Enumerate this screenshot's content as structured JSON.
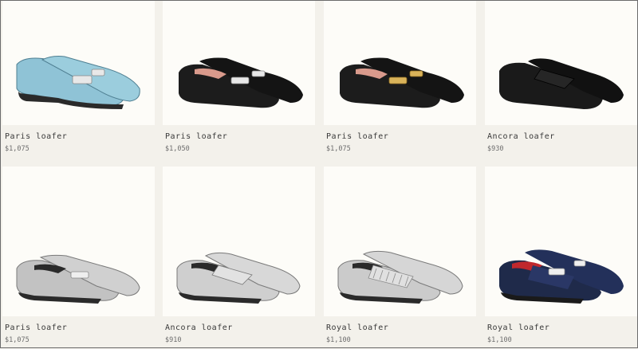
{
  "products": [
    {
      "name": "Paris loafer",
      "price": "$1,075",
      "color": "#8fc3d6",
      "hardware": "silver-h-buckle-icon"
    },
    {
      "name": "Paris loafer",
      "price": "$1,050",
      "color": "#1c1c1c",
      "hardware": "silver-h-buckle-icon"
    },
    {
      "name": "Paris loafer",
      "price": "$1,075",
      "color": "#1c1c1c",
      "hardware": "gold-h-buckle-icon"
    },
    {
      "name": "Ancora loafer",
      "price": "$930",
      "color": "#1a1a1a",
      "hardware": "none"
    },
    {
      "name": "Paris loafer",
      "price": "$1,075",
      "color": "#c2c2c2",
      "hardware": "silver-h-buckle-icon"
    },
    {
      "name": "Ancora loafer",
      "price": "$910",
      "color": "#cfcfcf",
      "hardware": "none"
    },
    {
      "name": "Royal loafer",
      "price": "$1,100",
      "color": "#cbcbcb",
      "hardware": "fringe-icon"
    },
    {
      "name": "Royal loafer",
      "price": "$1,100",
      "color": "#1f2a4a",
      "hardware": "silver-h-buckle-icon"
    }
  ]
}
